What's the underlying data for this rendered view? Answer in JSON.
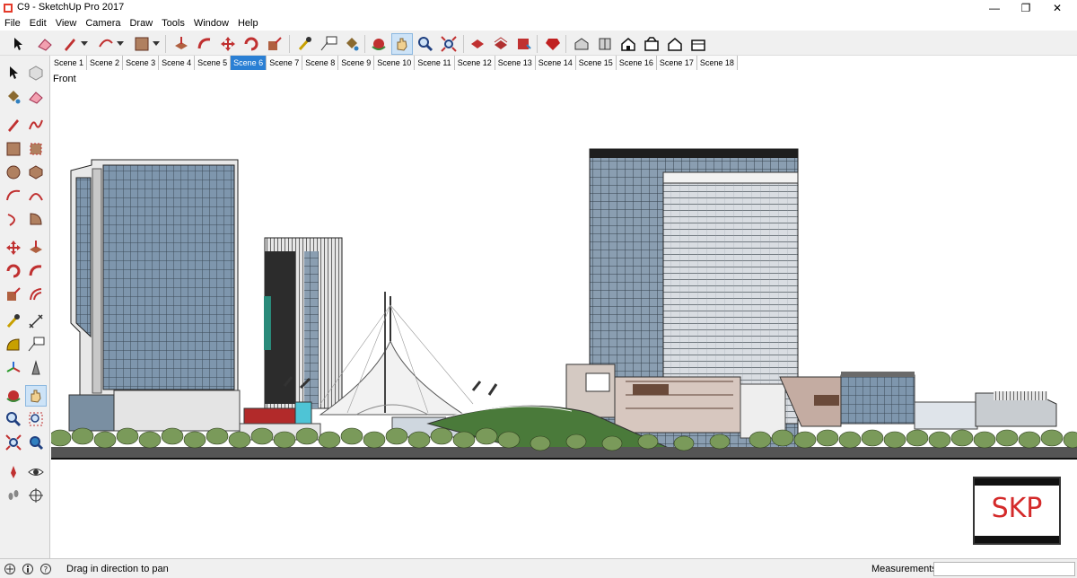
{
  "window": {
    "title": "C9 - SketchUp Pro 2017",
    "minimize": "—",
    "maximize": "❐",
    "close": "✕"
  },
  "menu": [
    "File",
    "Edit",
    "View",
    "Camera",
    "Draw",
    "Tools",
    "Window",
    "Help"
  ],
  "scene_tabs": [
    "Scene 1",
    "Scene 2",
    "Scene 3",
    "Scene 4",
    "Scene 5",
    "Scene 6",
    "Scene 7",
    "Scene 8",
    "Scene 9",
    "Scene 10",
    "Scene 11",
    "Scene 12",
    "Scene 13",
    "Scene 14",
    "Scene 15",
    "Scene 16",
    "Scene 17",
    "Scene 18"
  ],
  "active_scene": "Scene 6",
  "view_label": "Front",
  "status": {
    "hint": "Drag in direction to pan",
    "measurements_label": "Measurements",
    "measurements_value": ""
  },
  "logo_text": "SKP",
  "colors": {
    "accent": "#2a7fd4",
    "logo_red": "#d42a2a"
  }
}
